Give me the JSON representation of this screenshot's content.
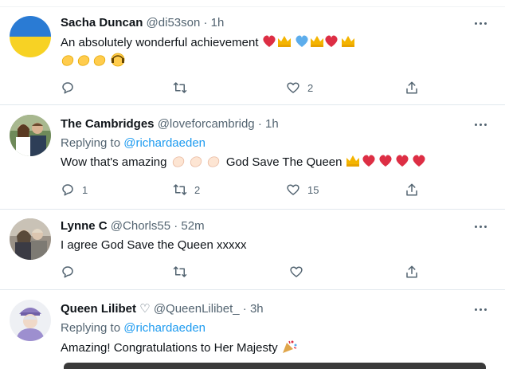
{
  "tweets": [
    {
      "name": "Sacha Duncan",
      "handle": "@di53son",
      "time": "1h",
      "text": "An absolutely wonderful achievement",
      "text_emoji": "❤️👑 💙👑❤️👑",
      "text_line2": "👏👏👏🙃",
      "reply_count": "",
      "retweet_count": "",
      "like_count": "2"
    },
    {
      "name": "The Cambridges",
      "handle": "@loveforcambridg",
      "time": "1h",
      "replying_label": "Replying to",
      "replying_handle": "@richardaeden",
      "text": "Wow that's amazing",
      "text_emoji_1": "👏🏻👏🏻👏🏻",
      "text_mid": "God Save The Queen",
      "text_emoji_2": "👑❤️❤️❤️❤️",
      "reply_count": "1",
      "retweet_count": "2",
      "like_count": "15"
    },
    {
      "name": "Lynne C",
      "handle": "@Chorls55",
      "time": "52m",
      "text": "I agree God Save the Queen xxxxx",
      "reply_count": "",
      "retweet_count": "",
      "like_count": ""
    },
    {
      "name": "Queen Lilibet",
      "name_emoji": "♡",
      "handle": "@QueenLilibet_",
      "time": "3h",
      "replying_label": "Replying to",
      "replying_handle": "@richardaeden",
      "text": "Amazing! Congratulations to Her Majesty",
      "text_emoji": "🎉"
    }
  ],
  "separator": "·",
  "icons": {
    "reply": "reply-icon",
    "retweet": "retweet-icon",
    "like": "heart-icon",
    "share": "share-icon",
    "more": "more-icon"
  },
  "colors": {
    "accent": "#1d9bf0",
    "secondary_text": "#536471",
    "heart": "#e0245e",
    "crown": "#f4b400",
    "clap": "#ffcc4d"
  }
}
